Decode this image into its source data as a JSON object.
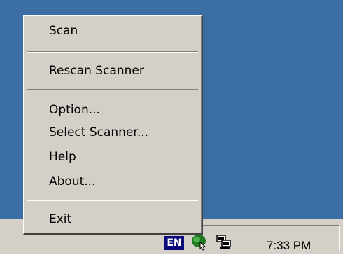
{
  "context_menu": {
    "items": [
      {
        "label": "Scan"
      },
      {
        "label": "Rescan Scanner"
      },
      {
        "label": "Option..."
      },
      {
        "label": "Select Scanner..."
      },
      {
        "label": "Help"
      },
      {
        "label": "About..."
      },
      {
        "label": "Exit"
      }
    ]
  },
  "taskbar": {
    "tray": {
      "language_indicator": "EN",
      "clock": "7:33 PM",
      "icons": [
        "scanner-tray-icon",
        "network-icon"
      ]
    }
  },
  "colors": {
    "desktop": "#3a6ea5",
    "menu_background": "#d4d0c8",
    "language_badge": "#0a0a7a"
  }
}
